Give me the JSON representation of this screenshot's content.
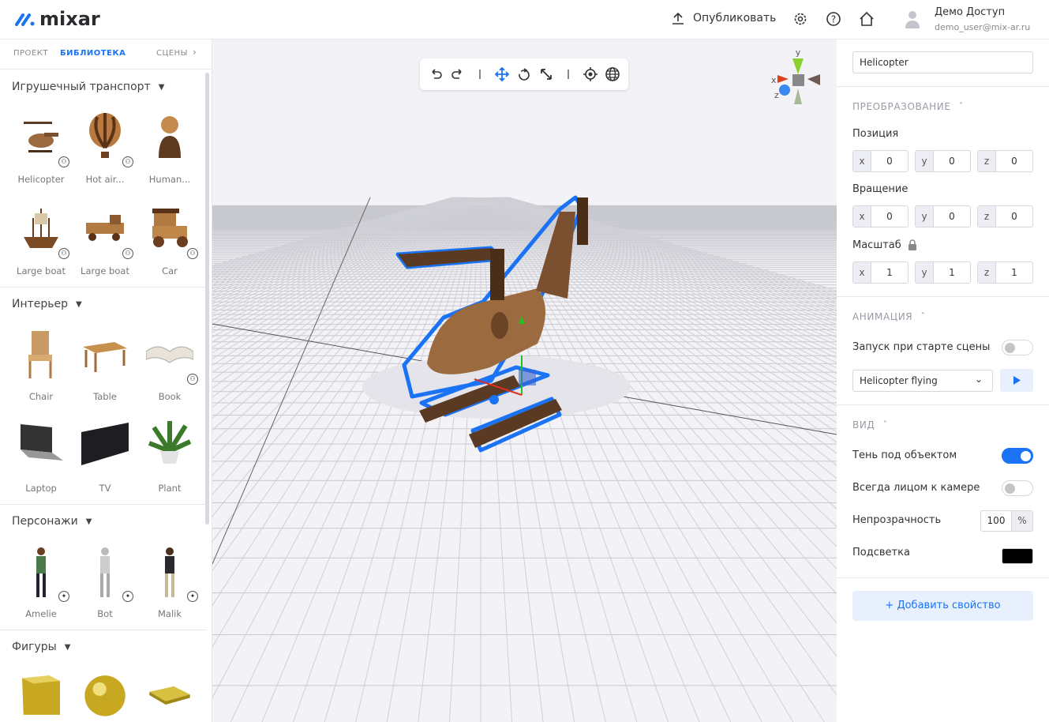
{
  "header": {
    "logo": "mixar",
    "publish_label": "Опубликовать",
    "user_name": "Демо Доступ",
    "user_email": "demo_user@mix-ar.ru"
  },
  "left": {
    "tabs": [
      {
        "label": "ПРОЕКТ"
      },
      {
        "label": "БИБЛИОТЕКА"
      },
      {
        "label": "СЦЕНЫ"
      }
    ],
    "sections": [
      {
        "title": "Игрушечный транспорт",
        "items": [
          {
            "label": "Helicopter"
          },
          {
            "label": "Hot air..."
          },
          {
            "label": "Human..."
          },
          {
            "label": "Large boat"
          },
          {
            "label": "Large boat"
          },
          {
            "label": "Car"
          }
        ]
      },
      {
        "title": "Интерьер",
        "items": [
          {
            "label": "Chair"
          },
          {
            "label": "Table"
          },
          {
            "label": "Book"
          },
          {
            "label": "Laptop"
          },
          {
            "label": "TV"
          },
          {
            "label": "Plant"
          }
        ]
      },
      {
        "title": "Персонажи",
        "items": [
          {
            "label": "Amelie"
          },
          {
            "label": "Bot"
          },
          {
            "label": "Malik"
          }
        ]
      },
      {
        "title": "Фигуры",
        "items": []
      }
    ]
  },
  "gizmo": {
    "x": "x",
    "y": "y",
    "z": "z"
  },
  "right": {
    "object_name": "Helicopter",
    "transform_title": "ПРЕОБРАЗОВАНИЕ",
    "position_label": "Позиция",
    "position": {
      "x": "0",
      "y": "0",
      "z": "0"
    },
    "rotation_label": "Вращение",
    "rotation": {
      "x": "0",
      "y": "0",
      "z": "0"
    },
    "scale_label": "Масштаб",
    "scale": {
      "x": "1",
      "y": "1",
      "z": "1"
    },
    "axis": {
      "x": "x",
      "y": "y",
      "z": "z"
    },
    "animation_title": "АНИМАЦИЯ",
    "autostart_label": "Запуск при старте сцены",
    "autostart": false,
    "animation_selected": "Helicopter flying",
    "view_title": "ВИД",
    "shadow_label": "Тень под объектом",
    "shadow": true,
    "face_camera_label": "Всегда лицом к камере",
    "face_camera": false,
    "opacity_label": "Непрозрачность",
    "opacity": "100",
    "opacity_unit": "%",
    "highlight_label": "Подсветка",
    "highlight_color": "#000000",
    "add_property_label": "+  Добавить свойство"
  },
  "colors": {
    "accent": "#1a73f5"
  }
}
